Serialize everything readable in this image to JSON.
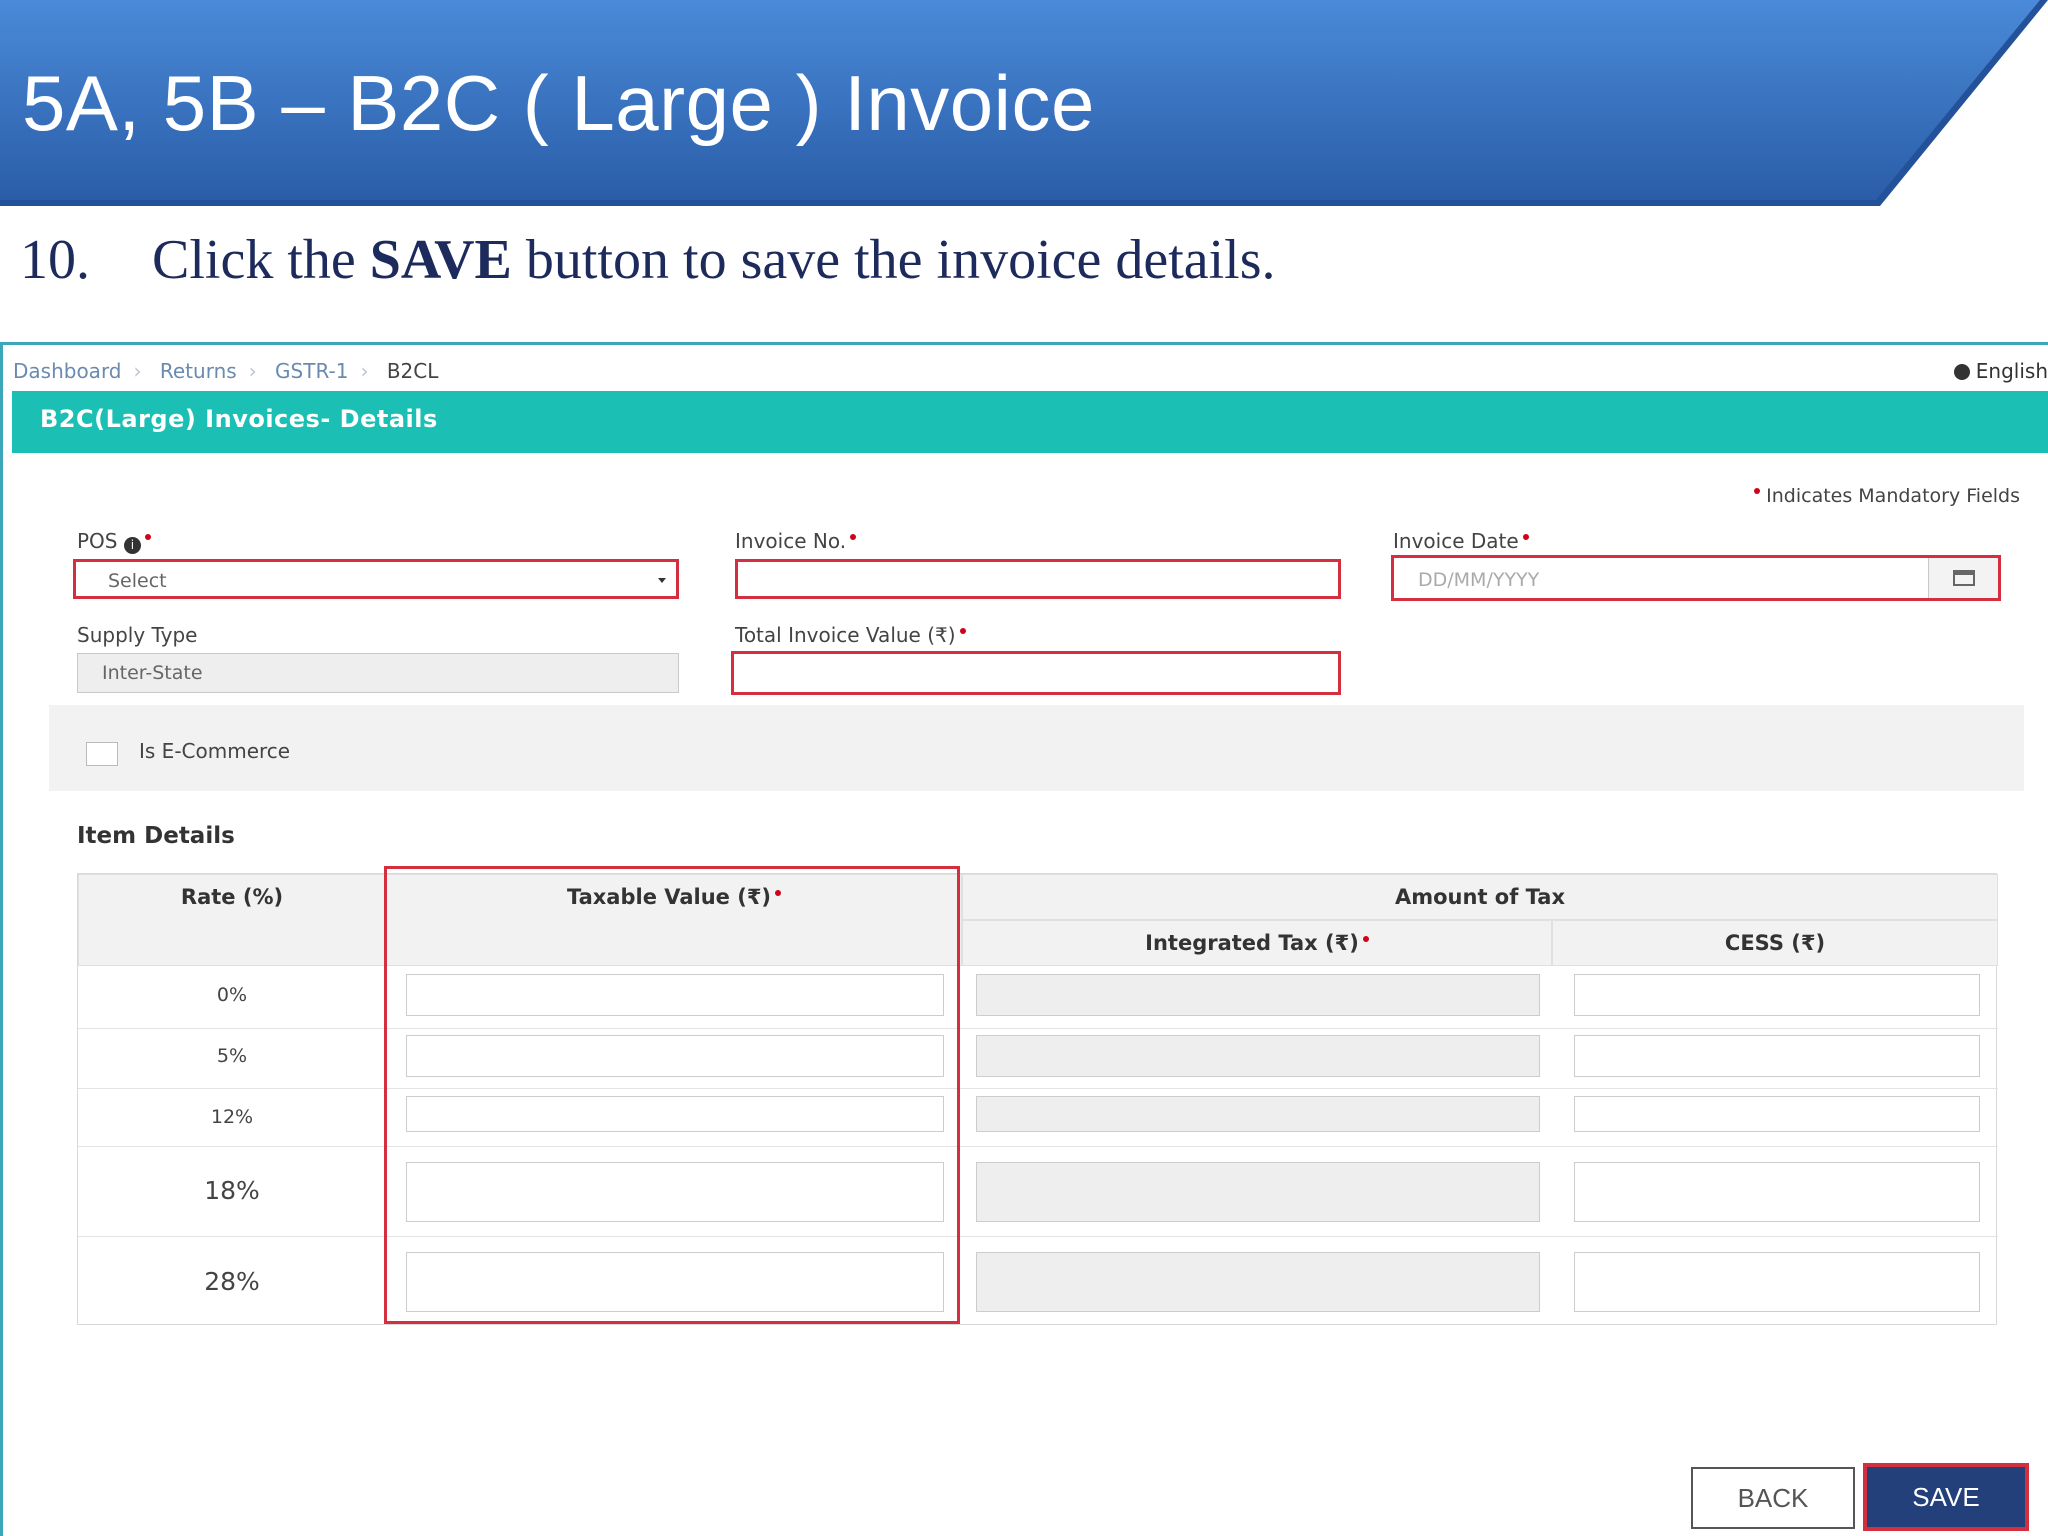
{
  "slide": {
    "title": "5A, 5B – B2C ( Large ) Invoice",
    "step_number": "10.",
    "instruction_prefix": "Click the",
    "instruction_bold": "SAVE",
    "instruction_suffix": "button to save the invoice details."
  },
  "breadcrumb": [
    "Dashboard",
    "Returns",
    "GSTR-1",
    "B2CL"
  ],
  "language": "English",
  "panel_title": "B2C(Large) Invoices- Details",
  "mandatory_note": "Indicates Mandatory Fields",
  "form": {
    "pos_label": "POS",
    "pos_value": "Select",
    "invoice_no_label": "Invoice No.",
    "invoice_no_value": "",
    "invoice_date_label": "Invoice Date",
    "invoice_date_placeholder": "DD/MM/YYYY",
    "supply_type_label": "Supply Type",
    "supply_type_value": "Inter-State",
    "total_value_label": "Total Invoice Value (₹)",
    "total_value_value": "",
    "ecommerce_label": "Is E-Commerce"
  },
  "item_details": {
    "title": "Item Details",
    "headers": {
      "rate": "Rate (%)",
      "taxable": "Taxable Value (₹)",
      "amount_of_tax": "Amount of Tax",
      "integrated": "Integrated Tax (₹)",
      "cess": "CESS (₹)"
    },
    "rates": [
      "0%",
      "5%",
      "12%",
      "18%",
      "28%"
    ]
  },
  "buttons": {
    "back": "BACK",
    "save": "SAVE"
  },
  "colors": {
    "banner": "#3d78c8",
    "teal": "#1bbfb4",
    "highlight": "#d32f3f",
    "save_bg": "#23407a"
  }
}
